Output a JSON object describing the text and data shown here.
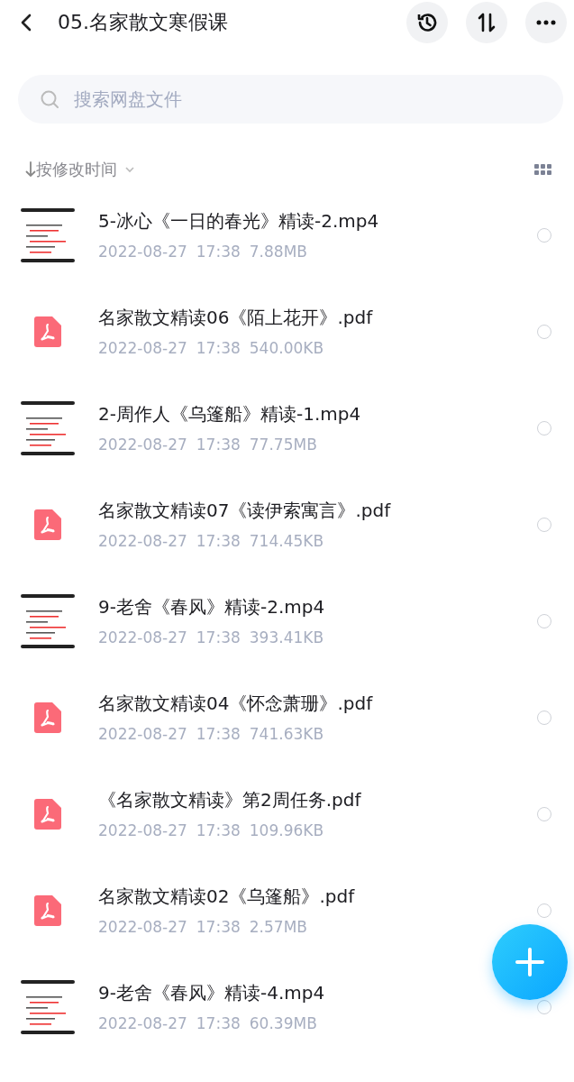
{
  "header": {
    "title": "05.名家散文寒假课"
  },
  "search": {
    "placeholder": "搜索网盘文件"
  },
  "sort": {
    "label": "按修改时间"
  },
  "files": [
    {
      "kind": "video",
      "name": "5-冰心《一日的春光》精读-2.mp4",
      "date": "2022-08-27",
      "time": "17:38",
      "size": "7.88MB",
      "selected": false
    },
    {
      "kind": "pdf",
      "name": "名家散文精读06《陌上花开》.pdf",
      "date": "2022-08-27",
      "time": "17:38",
      "size": "540.00KB",
      "selected": false
    },
    {
      "kind": "video",
      "name": "2-周作人《乌篷船》精读-1.mp4",
      "date": "2022-08-27",
      "time": "17:38",
      "size": "77.75MB",
      "selected": false
    },
    {
      "kind": "pdf",
      "name": "名家散文精读07《读伊索寓言》.pdf",
      "date": "2022-08-27",
      "time": "17:38",
      "size": "714.45KB",
      "selected": false
    },
    {
      "kind": "video",
      "name": "9-老舍《春风》精读-2.mp4",
      "date": "2022-08-27",
      "time": "17:38",
      "size": "393.41KB",
      "selected": false
    },
    {
      "kind": "pdf",
      "name": "名家散文精读04《怀念萧珊》.pdf",
      "date": "2022-08-27",
      "time": "17:38",
      "size": "741.63KB",
      "selected": false
    },
    {
      "kind": "pdf",
      "name": "《名家散文精读》第2周任务.pdf",
      "date": "2022-08-27",
      "time": "17:38",
      "size": "109.96KB",
      "selected": false
    },
    {
      "kind": "pdf",
      "name": "名家散文精读02《乌篷船》.pdf",
      "date": "2022-08-27",
      "time": "17:38",
      "size": "2.57MB",
      "selected": false
    },
    {
      "kind": "video",
      "name": "9-老舍《春风》精读-4.mp4",
      "date": "2022-08-27",
      "time": "17:38",
      "size": "60.39MB",
      "selected": false
    }
  ]
}
